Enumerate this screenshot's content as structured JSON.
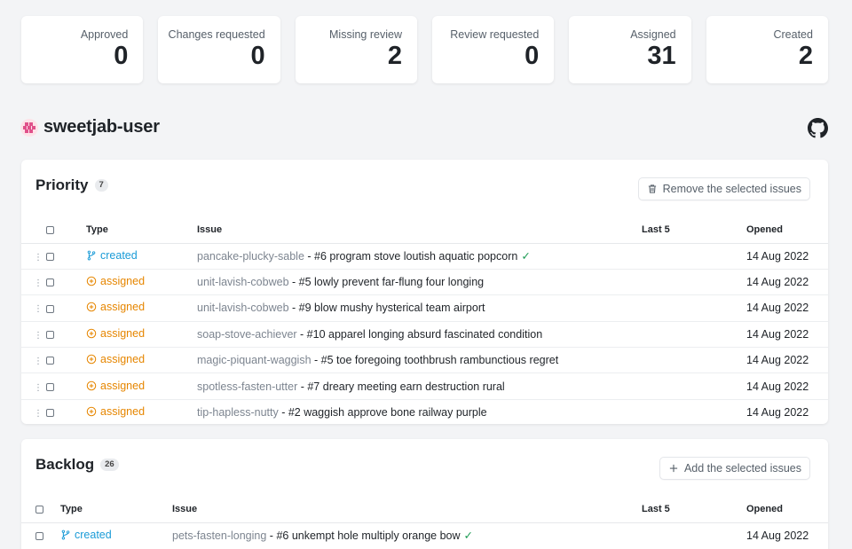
{
  "stats": [
    {
      "label": "Approved",
      "value": "0"
    },
    {
      "label": "Changes requested",
      "value": "0"
    },
    {
      "label": "Missing review",
      "value": "2"
    },
    {
      "label": "Review requested",
      "value": "0"
    },
    {
      "label": "Assigned",
      "value": "31"
    },
    {
      "label": "Created",
      "value": "2"
    }
  ],
  "user": {
    "name": "sweetjab-user",
    "github_icon": "github-icon"
  },
  "priority": {
    "title": "Priority",
    "count": "7",
    "action_label": "Remove the selected issues",
    "action_icon": "trash-icon",
    "columns": {
      "type": "Type",
      "issue": "Issue",
      "last5": "Last 5",
      "opened": "Opened"
    },
    "rows": [
      {
        "type": "created",
        "repo": "pancake-plucky-sable",
        "sep": " - ",
        "issue": "#6 program stove loutish aquatic popcorn",
        "approved": true,
        "opened": "14 Aug 2022"
      },
      {
        "type": "assigned",
        "repo": "unit-lavish-cobweb",
        "sep": " - ",
        "issue": "#5 lowly prevent far-flung four longing",
        "approved": false,
        "opened": "14 Aug 2022"
      },
      {
        "type": "assigned",
        "repo": "unit-lavish-cobweb",
        "sep": " - ",
        "issue": "#9 blow mushy hysterical team airport",
        "approved": false,
        "opened": "14 Aug 2022"
      },
      {
        "type": "assigned",
        "repo": "soap-stove-achiever",
        "sep": " - ",
        "issue": "#10 apparel longing absurd fascinated condition",
        "approved": false,
        "opened": "14 Aug 2022"
      },
      {
        "type": "assigned",
        "repo": "magic-piquant-waggish",
        "sep": " - ",
        "issue": "#5 toe foregoing toothbrush rambunctious regret",
        "approved": false,
        "opened": "14 Aug 2022"
      },
      {
        "type": "assigned",
        "repo": "spotless-fasten-utter",
        "sep": " - ",
        "issue": "#7 dreary meeting earn destruction rural",
        "approved": false,
        "opened": "14 Aug 2022"
      },
      {
        "type": "assigned",
        "repo": "tip-hapless-nutty",
        "sep": " - ",
        "issue": "#2 waggish approve bone railway purple",
        "approved": false,
        "opened": "14 Aug 2022"
      }
    ]
  },
  "backlog": {
    "title": "Backlog",
    "count": "26",
    "action_label": "Add the selected issues",
    "action_icon": "plus-icon",
    "columns": {
      "type": "Type",
      "issue": "Issue",
      "last5": "Last 5",
      "opened": "Opened"
    },
    "rows": [
      {
        "type": "created",
        "repo": "pets-fasten-longing",
        "sep": " - ",
        "issue": "#6 unkempt hole multiply orange bow",
        "approved": true,
        "opened": "14 Aug 2022"
      }
    ]
  },
  "colors": {
    "created": "#1a9bd7",
    "assigned": "#e68600",
    "approved_check": "#1a9a52"
  }
}
